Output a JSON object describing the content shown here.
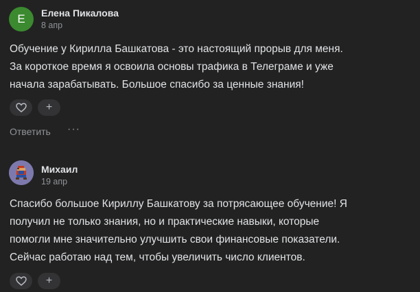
{
  "comments": [
    {
      "avatar_letter": "E",
      "author": "Елена Пикалова",
      "date": "8 апр",
      "text_lines": [
        "Обучение у Кирилла Башкатова - это настоящий прорыв для меня.",
        "За короткое время я освоила основы трафика в Телеграме и уже",
        "начала зарабатывать. Большое спасибо за ценные знания!"
      ],
      "add_label": "+",
      "reply_label": "Ответить",
      "more_label": "···"
    },
    {
      "author": "Михаил",
      "date": "19 апр",
      "text_lines": [
        "Спасибо большое Кириллу Башкатову за потрясающее обучение! Я",
        "получил не только знания, но и практические навыки, которые",
        "помогли мне значительно улучшить свои финансовые показатели.",
        "Сейчас работаю над тем, чтобы увеличить число клиентов."
      ],
      "add_label": "+"
    }
  ],
  "colors": {
    "background": "#222222",
    "text": "#e1e3e6",
    "secondary_text": "#909499",
    "button_bg": "#333335",
    "avatar_green": "#3b8a30"
  }
}
